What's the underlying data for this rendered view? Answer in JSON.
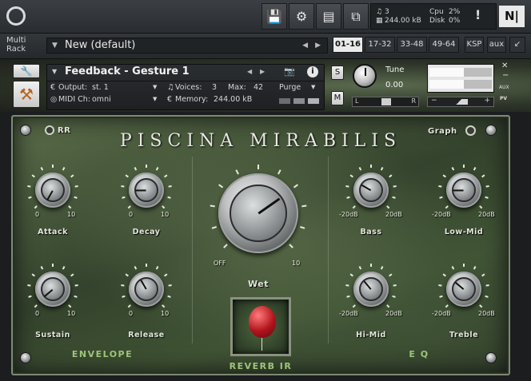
{
  "app": {
    "status": {
      "voices_icon": "voices-icon",
      "voices": "3",
      "memory": "244.00 kB",
      "cpu_label": "Cpu",
      "cpu": "2%",
      "disk_label": "Disk",
      "disk": "0%"
    }
  },
  "rack": {
    "label_line1": "Multi",
    "label_line2": "Rack",
    "preset": "New (default)",
    "tabs": [
      "01-16",
      "17-32",
      "33-48",
      "49-64",
      "KSP",
      "aux"
    ],
    "selected_tab": "01-16"
  },
  "instrument": {
    "name": "Feedback - Gesture 1",
    "output_label": "Output:",
    "output": "st. 1",
    "voices_label": "Voices:",
    "voices": "3",
    "max_label": "Max:",
    "max": "42",
    "purge": "Purge",
    "midi_label": "MIDI Ch:",
    "midi": "omni",
    "memory_label": "Memory:",
    "memory": "244.00 kB",
    "s_btn": "S",
    "m_btn": "M",
    "tune_label": "Tune",
    "tune_value": "0.00",
    "pan_l": "L",
    "pan_r": "R",
    "aux_label": "AUX",
    "pv_label": "PV"
  },
  "panel": {
    "title": "PISCINA MIRABILIS",
    "rr_label": "RR",
    "graph_label": "Graph",
    "envelope_label": "ENVELOPE",
    "reverb_label": "REVERB IR",
    "eq_label": "E Q",
    "knobs": {
      "attack": {
        "label": "Attack",
        "min": "0",
        "max": "10"
      },
      "decay": {
        "label": "Decay",
        "min": "0",
        "max": "10"
      },
      "sustain": {
        "label": "Sustain",
        "min": "0",
        "max": "10"
      },
      "release": {
        "label": "Release",
        "min": "0",
        "max": "10"
      },
      "wet": {
        "label": "Wet",
        "min": "OFF",
        "max": "10"
      },
      "bass": {
        "label": "Bass",
        "min": "-20dB",
        "max": "20dB"
      },
      "lowmid": {
        "label": "Low-Mid",
        "min": "-20dB",
        "max": "20dB"
      },
      "himid": {
        "label": "Hi-Mid",
        "min": "-20dB",
        "max": "20dB"
      },
      "treble": {
        "label": "Treble",
        "min": "-20dB",
        "max": "20dB"
      }
    }
  }
}
